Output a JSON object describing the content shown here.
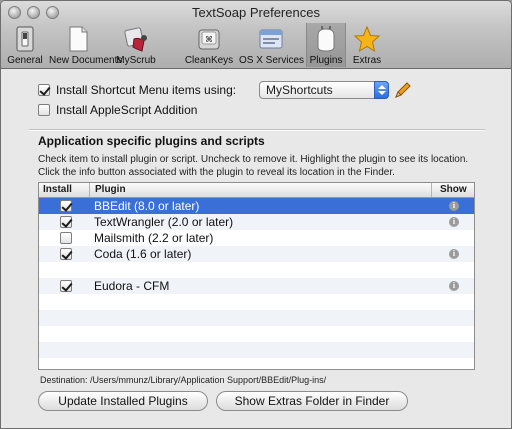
{
  "window": {
    "title": "TextSoap Preferences"
  },
  "toolbar": {
    "items": [
      {
        "label": "General",
        "icon": "switch-icon",
        "selected": false
      },
      {
        "label": "New Documents",
        "icon": "document-icon",
        "selected": false
      },
      {
        "label": "MyScrub",
        "icon": "scrub-icon",
        "selected": false
      },
      {
        "label": "CleanKeys",
        "icon": "keycap-icon",
        "selected": false
      },
      {
        "label": "OS X Services",
        "icon": "services-icon",
        "selected": false
      },
      {
        "label": "Plugins",
        "icon": "plugin-icon",
        "selected": true
      },
      {
        "label": "Extras",
        "icon": "star-icon",
        "selected": false
      }
    ]
  },
  "options": {
    "shortcut_label": "Install Shortcut Menu items using:",
    "shortcut_checked": true,
    "shortcut_value": "MyShortcuts",
    "applescript_label": "Install AppleScript Addition",
    "applescript_checked": false
  },
  "plugins": {
    "section_title": "Application specific plugins and scripts",
    "description": "Check item to install plugin or script. Uncheck to remove it. Highlight the plugin to see its location. Click the info button associated with the plugin to reveal its location in the Finder.",
    "columns": {
      "install": "Install",
      "plugin": "Plugin",
      "show": "Show"
    },
    "rows": [
      {
        "name": "BBEdit (8.0 or later)",
        "checked": true,
        "selected": true,
        "info": true
      },
      {
        "name": "TextWrangler (2.0 or later)",
        "checked": true,
        "selected": false,
        "info": true
      },
      {
        "name": "Mailsmith (2.2 or later)",
        "checked": false,
        "selected": false,
        "info": false
      },
      {
        "name": "Coda (1.6 or later)",
        "checked": true,
        "selected": false,
        "info": true
      },
      {
        "name": "",
        "checked": false,
        "selected": false,
        "info": false
      },
      {
        "name": "Eudora - CFM",
        "checked": true,
        "selected": false,
        "info": true
      }
    ],
    "info_glyph": "i"
  },
  "destination": {
    "label": "Destination:",
    "path": "/Users/mmunz/Library/Application Support/BBEdit/Plug-ins/"
  },
  "buttons": {
    "update": "Update Installed Plugins",
    "show_extras": "Show Extras Folder in Finder"
  },
  "colors": {
    "selection": "#3a6fd8",
    "popup_accent": "#2c6ee0"
  }
}
